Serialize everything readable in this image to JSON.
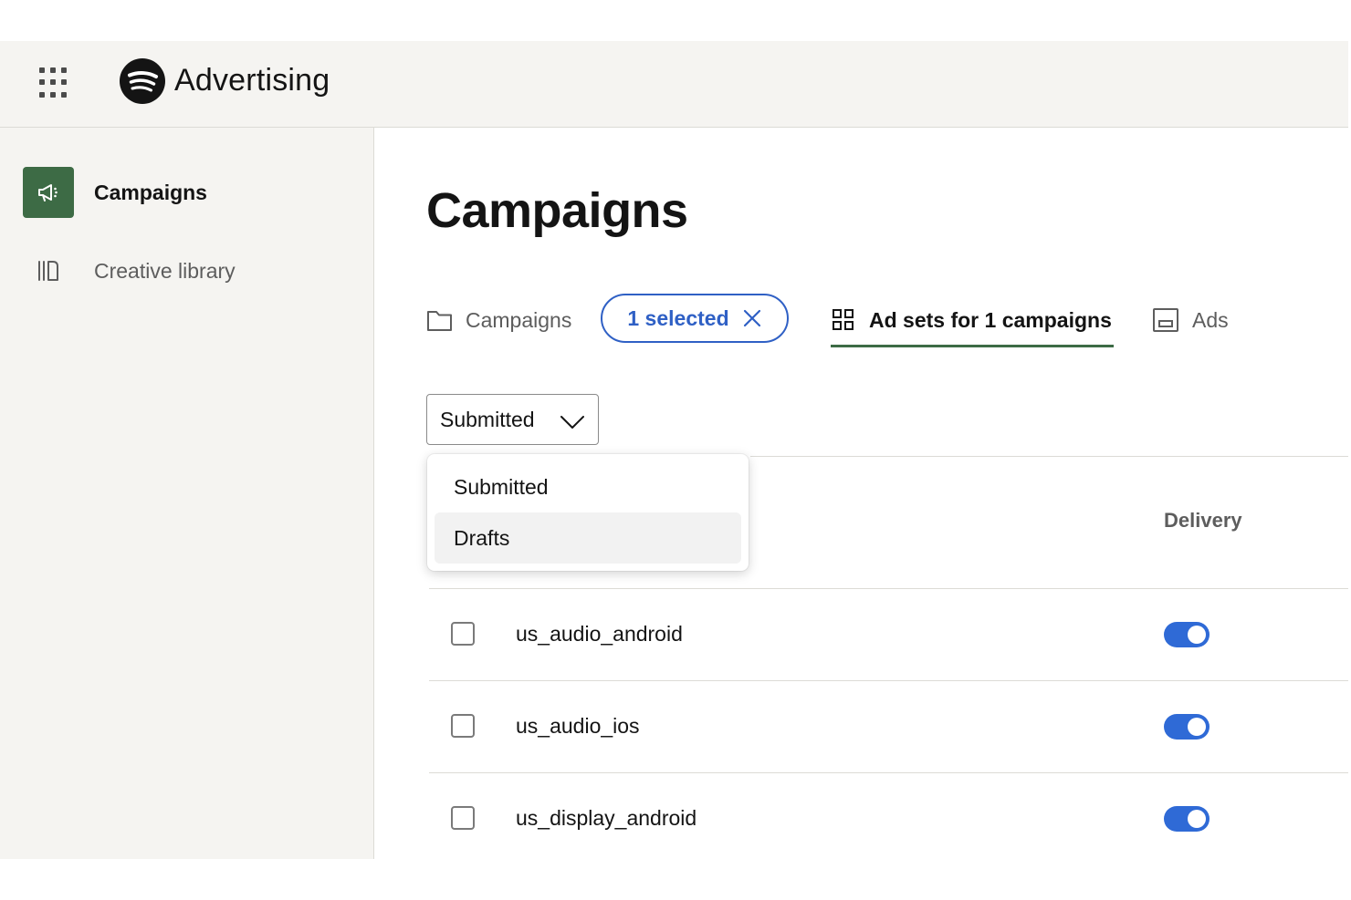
{
  "header": {
    "brand": "Advertising",
    "apps_icon": "grid-icon",
    "logo_icon": "spotify-logo"
  },
  "sidebar": {
    "items": [
      {
        "label": "Campaigns",
        "icon": "megaphone-icon",
        "active": true
      },
      {
        "label": "Creative library",
        "icon": "library-icon",
        "active": false
      }
    ]
  },
  "main": {
    "title": "Campaigns",
    "tabs": [
      {
        "label": "Campaigns",
        "icon": "folder-icon"
      },
      {
        "label": "Ad sets for 1 campaigns",
        "icon": "grid-icon",
        "active": true
      },
      {
        "label": "Ads",
        "icon": "ad-icon"
      }
    ],
    "selection_chip": {
      "label": "1 selected",
      "icon": "close-icon"
    },
    "filter": {
      "value": "Submitted",
      "options": [
        "Submitted",
        "Drafts"
      ],
      "hovered_option": "Drafts"
    },
    "table": {
      "columns": {
        "delivery": "Delivery"
      },
      "rows": [
        {
          "name": "us_audio_android",
          "delivery_on": true
        },
        {
          "name": "us_audio_ios",
          "delivery_on": true
        },
        {
          "name": "us_display_android",
          "delivery_on": true
        }
      ]
    }
  },
  "colors": {
    "accent_green": "#3d6b45",
    "selection_blue": "#2f60c5",
    "toggle_blue": "#2f6ad6",
    "sidebar_bg": "#f5f4f1"
  }
}
